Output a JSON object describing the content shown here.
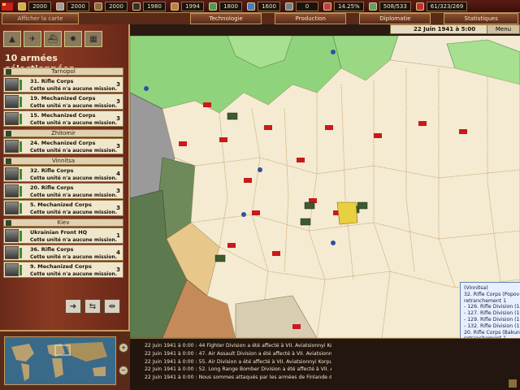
{
  "topbar": {
    "resources": [
      {
        "name": "energy",
        "value": "2000",
        "color": "#d8b040"
      },
      {
        "name": "metal",
        "value": "2000",
        "color": "#a0a0a0"
      },
      {
        "name": "rare-materials",
        "value": "2000",
        "color": "#8a6a40"
      },
      {
        "name": "oil",
        "value": "1980",
        "color": "#303030"
      },
      {
        "name": "supplies",
        "value": "1994",
        "color": "#c08040"
      },
      {
        "name": "money",
        "value": "1800",
        "color": "#40a050"
      },
      {
        "name": "transports",
        "value": "1600",
        "color": "#4080c0"
      },
      {
        "name": "escorts",
        "value": "0",
        "color": "#708090"
      },
      {
        "name": "dissent",
        "value": "14.25%",
        "color": "#c04040"
      },
      {
        "name": "manpower",
        "value": "508/533",
        "color": "#60a060"
      },
      {
        "name": "ic",
        "value": "61/323/269",
        "color": "#c03030"
      }
    ]
  },
  "tabs": {
    "map": "Afficher la carte",
    "tech": "Technologie",
    "prod": "Production",
    "diplo": "Diplomatie",
    "stats": "Statistiques"
  },
  "datebar": {
    "date": "22 Juin 1941 à 5:00",
    "menu": "Menu"
  },
  "leftpanel": {
    "title": "10 armées sélectionnées.",
    "groups": [
      {
        "name": "Tarnopol",
        "units": [
          {
            "name": "31. Rifle Corps",
            "status": "Cette unité n'a aucune mission.",
            "count": "3"
          },
          {
            "name": "19. Mechanized Corps",
            "status": "Cette unité n'a aucune mission.",
            "count": "3"
          },
          {
            "name": "15. Mechanized Corps",
            "status": "Cette unité n'a aucune mission.",
            "count": "3"
          }
        ]
      },
      {
        "name": "Zhitomir",
        "units": [
          {
            "name": "24. Mechanized Corps",
            "status": "Cette unité n'a aucune mission.",
            "count": "3"
          }
        ]
      },
      {
        "name": "Vinnitsa",
        "units": [
          {
            "name": "32. Rifle Corps",
            "status": "Cette unité n'a aucune mission.",
            "count": "4"
          },
          {
            "name": "20. Rifle Corps",
            "status": "Cette unité n'a aucune mission.",
            "count": "3"
          },
          {
            "name": "5. Mechanized Corps",
            "status": "Cette unité n'a aucune mission.",
            "count": "3"
          }
        ]
      },
      {
        "name": "Kiev",
        "units": [
          {
            "name": "Ukrainian Front HQ",
            "status": "Cette unité n'a aucune mission.",
            "count": "1"
          },
          {
            "name": "36. Rifle Corps",
            "status": "Cette unité n'a aucune mission.",
            "count": "4"
          },
          {
            "name": "9. Mechanized Corps",
            "status": "Cette unité n'a aucune mission.",
            "count": "3"
          }
        ]
      }
    ]
  },
  "tooltip": {
    "lines": [
      "(Vinnitsa)",
      "32. Rifle Corps (Popov M.M.)    (400/41) -",
      "retranchement 1",
      "- 126. Rifle Division (100/41) (Infanterie)",
      "- 127. Rifle Division (100/41) (Infanterie)",
      "- 129. Rifle Division (100/41) (Infanterie)",
      "- 132. Rifle Division (100/41) (Infanterie)",
      "20. Rifle Corps (Bakunin)    (300/41) -",
      "retranchement 1",
      "- 136. Rifle Division (100/41) (Infanterie)",
      "- 144. Rifle Division (100/41) (Infanterie)",
      "- 160. Rifle Division (100/41) (Infanterie)",
      "5. Mechanized Corps (Petrushevskii)    (300/41) -",
      "retranchement 1",
      "- 13. Tank Division (100/41) Blindé Lg.",
      "- 17. Tank Division (100/41) Blindé Lg.-(AC)",
      "- 109 Motorized Division (100/41) (Inf. mot.)"
    ]
  },
  "log": {
    "lines": [
      "22 Juin 1941 à 0:00 : 44 Fighter Division a été affecté à VII. Aviatsionnyi Korpus",
      "22 Juin 1941 à 0:00 : 47. Air Assault Division a été affecté à VII. Aviatsionnyi Korpus",
      "22 Juin 1941 à 0:00 : 55. Air Division a été affecté à VII. Aviatsionnyi Korpus",
      "22 Juin 1941 à 0:00 : 52. Long Range Bomber Division a été affecté à VII. Aviatsionnyi Korpus",
      "22 Juin 1941 à 0:00 : Nous sommes attaqués par les armées de Finlande dans la province de Sortavala."
    ]
  }
}
